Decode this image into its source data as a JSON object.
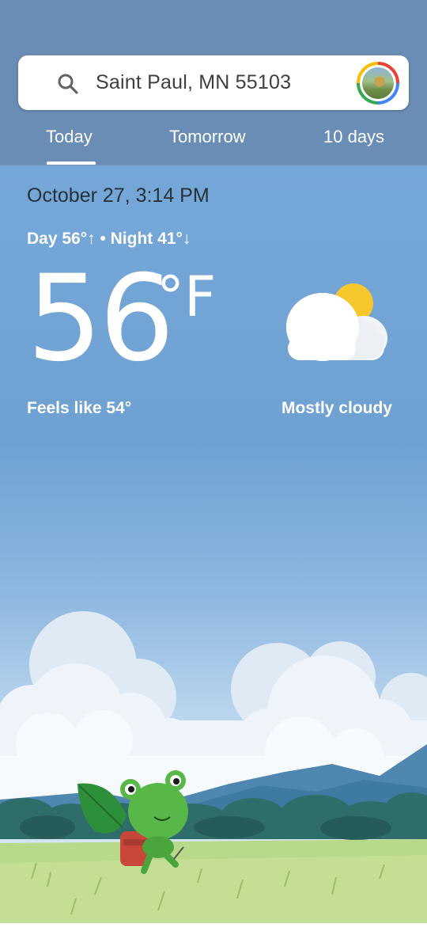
{
  "search": {
    "location": "Saint Paul, MN 55103",
    "icon": "search-icon"
  },
  "tabs": [
    {
      "label": "Today",
      "selected": true
    },
    {
      "label": "Tomorrow",
      "selected": false
    },
    {
      "label": "10 days",
      "selected": false
    }
  ],
  "weather": {
    "date_time": "October 27, 3:14 PM",
    "day_night": "Day 56°↑ • Night 41°↓",
    "temperature": "56",
    "unit": "°F",
    "feels_like": "Feels like 54°",
    "condition": "Mostly cloudy",
    "condition_icon": "partly-cloudy-icon"
  },
  "colors": {
    "header_bg": "#6a8db5",
    "sky_top": "#76a7d9",
    "sun": "#f6c82e",
    "text_dark": "#263238"
  }
}
